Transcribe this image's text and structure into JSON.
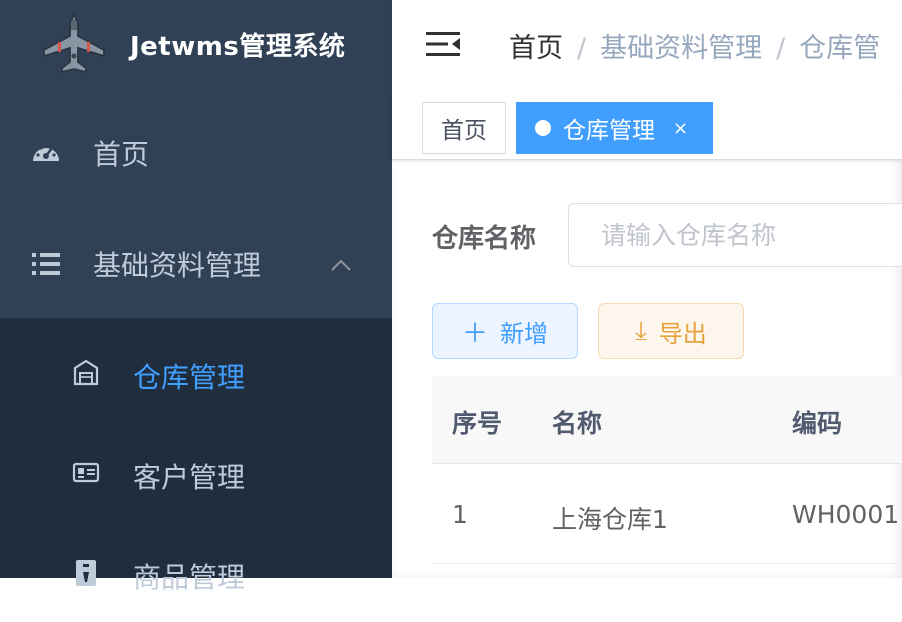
{
  "app": {
    "title": "Jetwms管理系统"
  },
  "sidebar": {
    "menu": [
      {
        "label": "首页",
        "icon": "dashboard-icon"
      },
      {
        "label": "基础资料管理",
        "icon": "list-icon",
        "expanded": true
      }
    ],
    "submenu": [
      {
        "label": "仓库管理",
        "icon": "warehouse-icon",
        "active": true
      },
      {
        "label": "客户管理",
        "icon": "id-card-icon"
      },
      {
        "label": "商品管理",
        "icon": "goods-icon"
      }
    ]
  },
  "navbar": {
    "breadcrumb": [
      "首页",
      "基础资料管理",
      "仓库管"
    ],
    "separator": "/"
  },
  "tags": {
    "home": "首页",
    "active": "仓库管理",
    "close": "×"
  },
  "filter": {
    "label": "仓库名称",
    "placeholder": "请输入仓库名称"
  },
  "buttons": {
    "add": "新增",
    "add_icon": "＋",
    "export": "导出",
    "export_icon": "⤓"
  },
  "table": {
    "columns": [
      "序号",
      "名称",
      "编码"
    ],
    "rows": [
      [
        "1",
        "上海仓库1",
        "WH0001"
      ]
    ]
  },
  "colors": {
    "sidebar_bg": "#304156",
    "submenu_bg": "#1f2d3d",
    "accent": "#409eff",
    "warning": "#e6a23c"
  }
}
